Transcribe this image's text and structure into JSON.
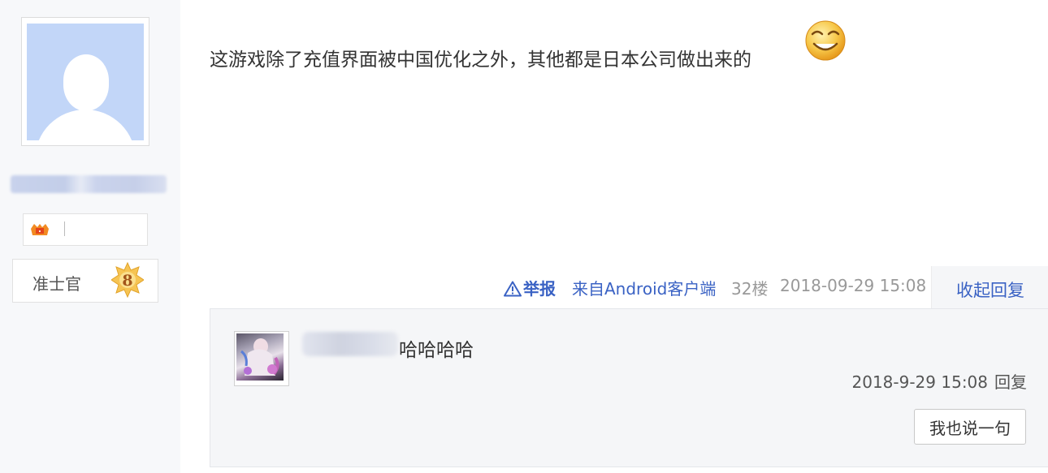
{
  "author": {
    "avatar": "default-avatar-silhouette",
    "fan_badge_icon": "fan-club-icon",
    "rank_title": "准士官",
    "rank_level": "8"
  },
  "post": {
    "content": "这游戏除了充值界面被中国优化之外，其他都是日本公司做出来的",
    "emoji": "smiley-emoji"
  },
  "tail": {
    "report_label": "举报",
    "client_label": "来自Android客户端",
    "floor": "32楼",
    "time": "2018-09-29 15:08",
    "fold_label": "收起回复"
  },
  "reply": {
    "content": "哈哈哈哈",
    "time": "2018-9-29 15:08",
    "reply_label": "回复",
    "say_button_label": "我也说一句"
  },
  "colors": {
    "link": "#3a62c4",
    "meta_gray": "#999999",
    "avatar_bg": "#c2d6f8",
    "reply_bg": "#f5f6f8"
  }
}
